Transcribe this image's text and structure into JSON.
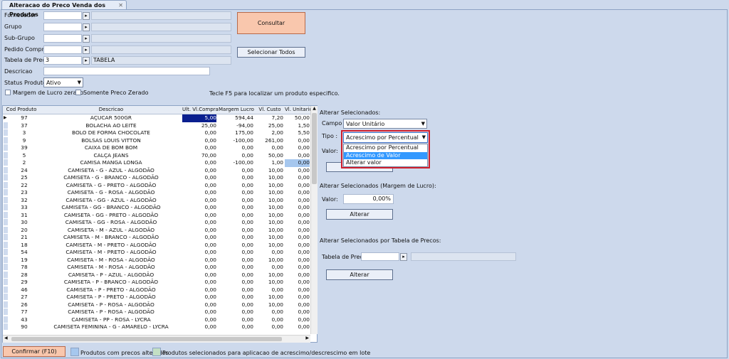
{
  "tab": {
    "title": "Alteracao do Preco Venda dos Produtos",
    "close": "✕"
  },
  "filters": {
    "fornecedor_label": "Fornecedor",
    "grupo_label": "Grupo",
    "subgrupo_label": "Sub-Grupo",
    "pedido_label": "Pedido Compra",
    "tabela_label": "Tabela de Preco",
    "tabela_code": "3",
    "tabela_name": "TABELA",
    "descricao_label": "Descricao",
    "status_label": "Status Produto:",
    "status_value": "Ativo",
    "margem_label": "Margem de Lucro zerado",
    "somente_label": "Somente Preco Zerado"
  },
  "buttons": {
    "consultar": "Consultar",
    "selecionar_todos": "Selecionar Todos",
    "confirmar": "Confirmar (F10)"
  },
  "hint": "Tecle F5 para localizar um produto especifico.",
  "grid": {
    "columns": [
      "Cod Produto",
      "Descricao",
      "Ult. Vl.Compra",
      "Margem Lucro",
      "Vl. Custo",
      "Vl. Unitario"
    ],
    "rows": [
      [
        "97",
        "AÇUCAR 500GR",
        "5,00",
        "594,44",
        "7,20",
        "50,00"
      ],
      [
        "37",
        "BOLACHA AO LEITE",
        "25,00",
        "-94,00",
        "25,00",
        "1,50"
      ],
      [
        "3",
        "BOLO DE FORMA CHOCOLATE",
        "0,00",
        "175,00",
        "2,00",
        "5,50"
      ],
      [
        "9",
        "BOLSAS LOUIS VITTON",
        "0,00",
        "-100,00",
        "261,00",
        "0,00"
      ],
      [
        "39",
        "CAIXA DE BOM BOM",
        "0,00",
        "0,00",
        "0,00",
        "0,00"
      ],
      [
        "5",
        "CALÇA JEANS",
        "70,00",
        "0,00",
        "50,00",
        "0,00"
      ],
      [
        "2",
        "CAMISA MANGA LONGA",
        "0,00",
        "-100,00",
        "1,00",
        "0,00"
      ],
      [
        "24",
        "CAMISETA - G - AZUL - ALGODÃO",
        "0,00",
        "0,00",
        "10,00",
        "0,00"
      ],
      [
        "25",
        "CAMISETA - G - BRANCO - ALGODÃO",
        "0,00",
        "0,00",
        "10,00",
        "0,00"
      ],
      [
        "22",
        "CAMISETA - G - PRETO - ALGODÃO",
        "0,00",
        "0,00",
        "10,00",
        "0,00"
      ],
      [
        "23",
        "CAMISETA - G - ROSA - ALGODÃO",
        "0,00",
        "0,00",
        "10,00",
        "0,00"
      ],
      [
        "32",
        "CAMISETA - GG - AZUL - ALGODÃO",
        "0,00",
        "0,00",
        "10,00",
        "0,00"
      ],
      [
        "33",
        "CAMISETA - GG - BRANCO - ALGODÃO",
        "0,00",
        "0,00",
        "10,00",
        "0,00"
      ],
      [
        "31",
        "CAMISETA - GG - PRETO - ALGODÃO",
        "0,00",
        "0,00",
        "10,00",
        "0,00"
      ],
      [
        "30",
        "CAMISETA - GG - ROSA - ALGODÃO",
        "0,00",
        "0,00",
        "10,00",
        "0,00"
      ],
      [
        "20",
        "CAMISETA - M - AZUL - ALGODÃO",
        "0,00",
        "0,00",
        "10,00",
        "0,00"
      ],
      [
        "21",
        "CAMISETA - M - BRANCO - ALGODÃO",
        "0,00",
        "0,00",
        "10,00",
        "0,00"
      ],
      [
        "18",
        "CAMISETA - M - PRETO - ALGODÃO",
        "0,00",
        "0,00",
        "10,00",
        "0,00"
      ],
      [
        "54",
        "CAMISETA - M - PRETO - ALGODÃO",
        "0,00",
        "0,00",
        "0,00",
        "0,00"
      ],
      [
        "19",
        "CAMISETA - M - ROSA - ALGODÃO",
        "0,00",
        "0,00",
        "10,00",
        "0,00"
      ],
      [
        "78",
        "CAMISETA - M - ROSA - ALGODÃO",
        "0,00",
        "0,00",
        "0,00",
        "0,00"
      ],
      [
        "28",
        "CAMISETA - P - AZUL - ALGODÃO",
        "0,00",
        "0,00",
        "10,00",
        "0,00"
      ],
      [
        "29",
        "CAMISETA - P - BRANCO - ALGODÃO",
        "0,00",
        "0,00",
        "10,00",
        "0,00"
      ],
      [
        "46",
        "CAMISETA - P - PRETO - ALGODÃO",
        "0,00",
        "0,00",
        "0,00",
        "0,00"
      ],
      [
        "27",
        "CAMISETA - P - PRETO - ALGODÃO",
        "0,00",
        "0,00",
        "10,00",
        "0,00"
      ],
      [
        "26",
        "CAMISETA - P - ROSA - ALGODÃO",
        "0,00",
        "0,00",
        "10,00",
        "0,00"
      ],
      [
        "77",
        "CAMISETA - P - ROSA - ALGODÃO",
        "0,00",
        "0,00",
        "0,00",
        "0,00"
      ],
      [
        "43",
        "CAMISETA - PP - ROSA - LYCRA",
        "0,00",
        "0,00",
        "0,00",
        "0,00"
      ],
      [
        "90",
        "CAMISETA FEMININA - G - AMARELO - LYCRA",
        "0,00",
        "0,00",
        "0,00",
        "0,00"
      ]
    ]
  },
  "right": {
    "alterar_sel_label": "Alterar Selecionados:",
    "campo_label": "Campo :",
    "campo_value": "Valor Unitário",
    "tipo_label": "Tipo :",
    "tipo_value": "Acrescimo por Percentual",
    "tipo_options": [
      "Acrescimo por Percentual",
      "Acrescimo de Valor",
      "Alterar valor"
    ],
    "valor_label": "Valor:",
    "alterar_btn": "Alterar",
    "margem_section": "Alterar Selecionados (Margem de Lucro):",
    "margem_valor_label": "Valor:",
    "margem_valor": "0,00%",
    "tabela_section": "Alterar Selecionados por Tabela de Precos:",
    "tabela_label": "Tabela de Preco"
  },
  "legend": {
    "alterados": "Produtos com precos alterados",
    "selecionados": "Produtos selecionados para aplicacao de acrescimo/descrescimo em lote"
  },
  "colors": {
    "accent_selected": "#0a1f8f",
    "legend_blue": "#a6c7ee",
    "legend_green": "#c3dfc4",
    "dropdown_highlight": "#3399ff",
    "dropdown_border": "#d01f2d"
  }
}
